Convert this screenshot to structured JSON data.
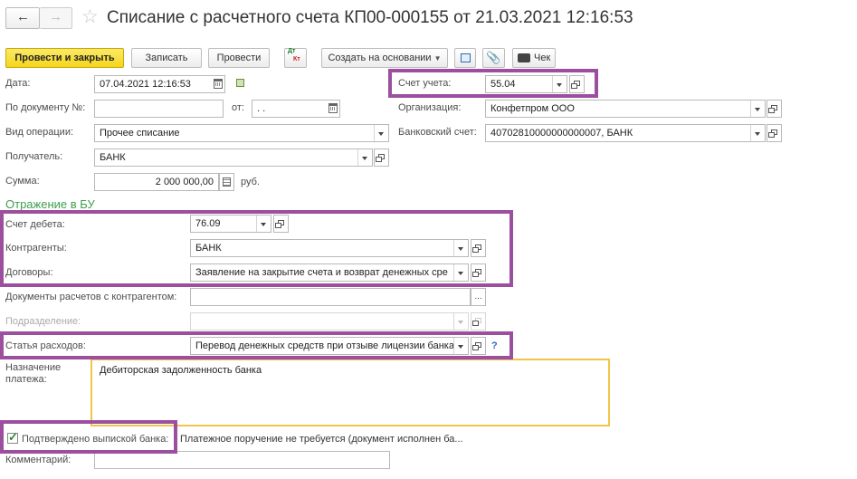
{
  "title": "Списание с расчетного счета КП00-000155 от 21.03.2021 12:16:53",
  "toolbar": {
    "post_close": "Провести и закрыть",
    "save": "Записать",
    "post": "Провести",
    "dt_kt_top": "Дт",
    "dt_kt_bottom": "Кт",
    "create_based": "Создать на основании",
    "check": "Чек"
  },
  "form": {
    "date_label": "Дата:",
    "date_value": "07.04.2021 12:16:53",
    "doc_num_label": "По документу №:",
    "doc_num_value": "",
    "from_label": "от:",
    "from_value": " .  .",
    "op_type_label": "Вид операции:",
    "op_type_value": "Прочее списание",
    "recipient_label": "Получатель:",
    "recipient_value": "БАНК",
    "sum_label": "Сумма:",
    "sum_value": "2 000 000,00",
    "currency": "руб.",
    "account_label": "Счет учета:",
    "account_value": "55.04",
    "org_label": "Организация:",
    "org_value": "Конфетпром ООО",
    "bank_acc_label": "Банковский счет:",
    "bank_acc_value": "40702810000000000007,  БАНК"
  },
  "bu": {
    "heading": "Отражение в БУ",
    "debit_label": "Счет дебета:",
    "debit_value": "76.09",
    "counterparty_label": "Контрагенты:",
    "counterparty_value": "БАНК",
    "contracts_label": "Договоры:",
    "contracts_value": "Заявление на закрытие счета и возврат денежных сре",
    "settlement_docs_label": "Документы расчетов с контрагентом:",
    "settlement_docs_value": "",
    "division_label": "Подразделение:",
    "division_value": "",
    "expense_label": "Статья расходов:",
    "expense_value": "Перевод денежных средств при отзыве лицензии банка",
    "help": "?"
  },
  "purpose": {
    "label": "Назначение платежа:",
    "value": "Дебиторская задолженность банка"
  },
  "confirm": {
    "label": "Подтверждено выпиской банка:",
    "checked": true,
    "note": "Платежное поручение не требуется (документ исполнен ба..."
  },
  "comment": {
    "label": "Комментарий:",
    "value": ""
  },
  "colors": {
    "highlight": "#9b4f9e",
    "primary_button": "#f5d61a",
    "section_heading": "#3f9e4a",
    "purpose_border": "#f0c64a"
  }
}
